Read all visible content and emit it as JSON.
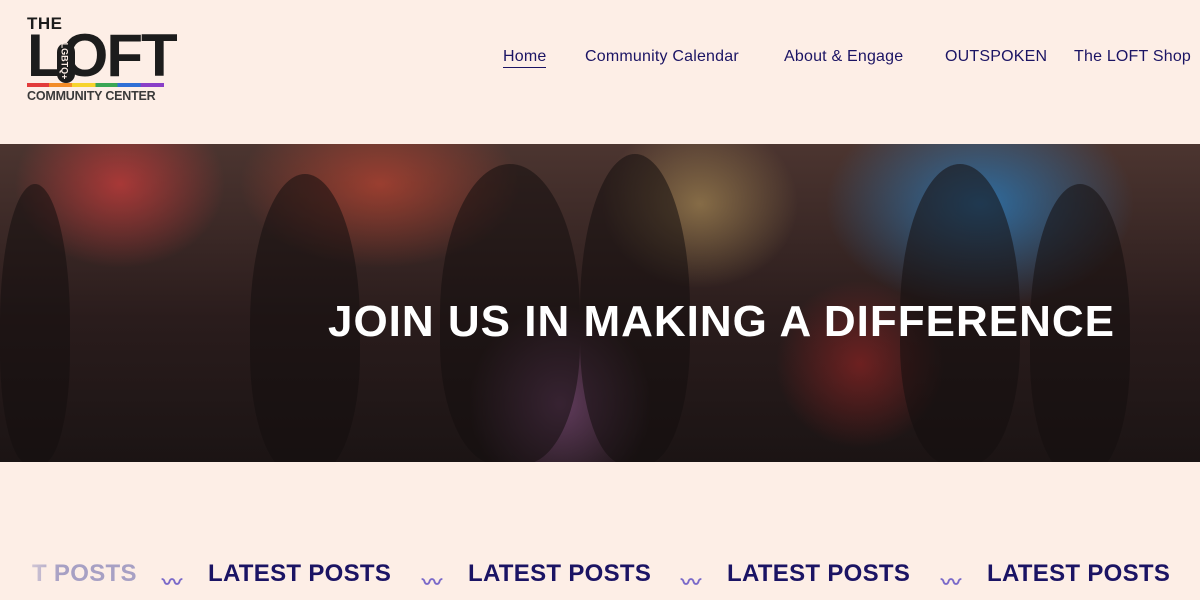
{
  "logo": {
    "the": "THE",
    "loft": "LOFT",
    "badge": "LGBTQ+",
    "subtitle": "COMMUNITY CENTER"
  },
  "nav": {
    "items": [
      {
        "label": "Home",
        "active": true
      },
      {
        "label": "Community Calendar",
        "active": false
      },
      {
        "label": "About & Engage",
        "active": false
      },
      {
        "label": "OUTSPOKEN",
        "active": false
      },
      {
        "label": "The LOFT Shop",
        "active": false
      }
    ]
  },
  "hero": {
    "title": "JOIN US IN MAKING A DIFFERENCE"
  },
  "latest_posts": {
    "partial_label": "T POSTS",
    "label": "LATEST POSTS",
    "separator": "〰"
  },
  "colors": {
    "background": "#fdeee6",
    "nav_text": "#1b1464",
    "wave": "#7b6ac9"
  }
}
